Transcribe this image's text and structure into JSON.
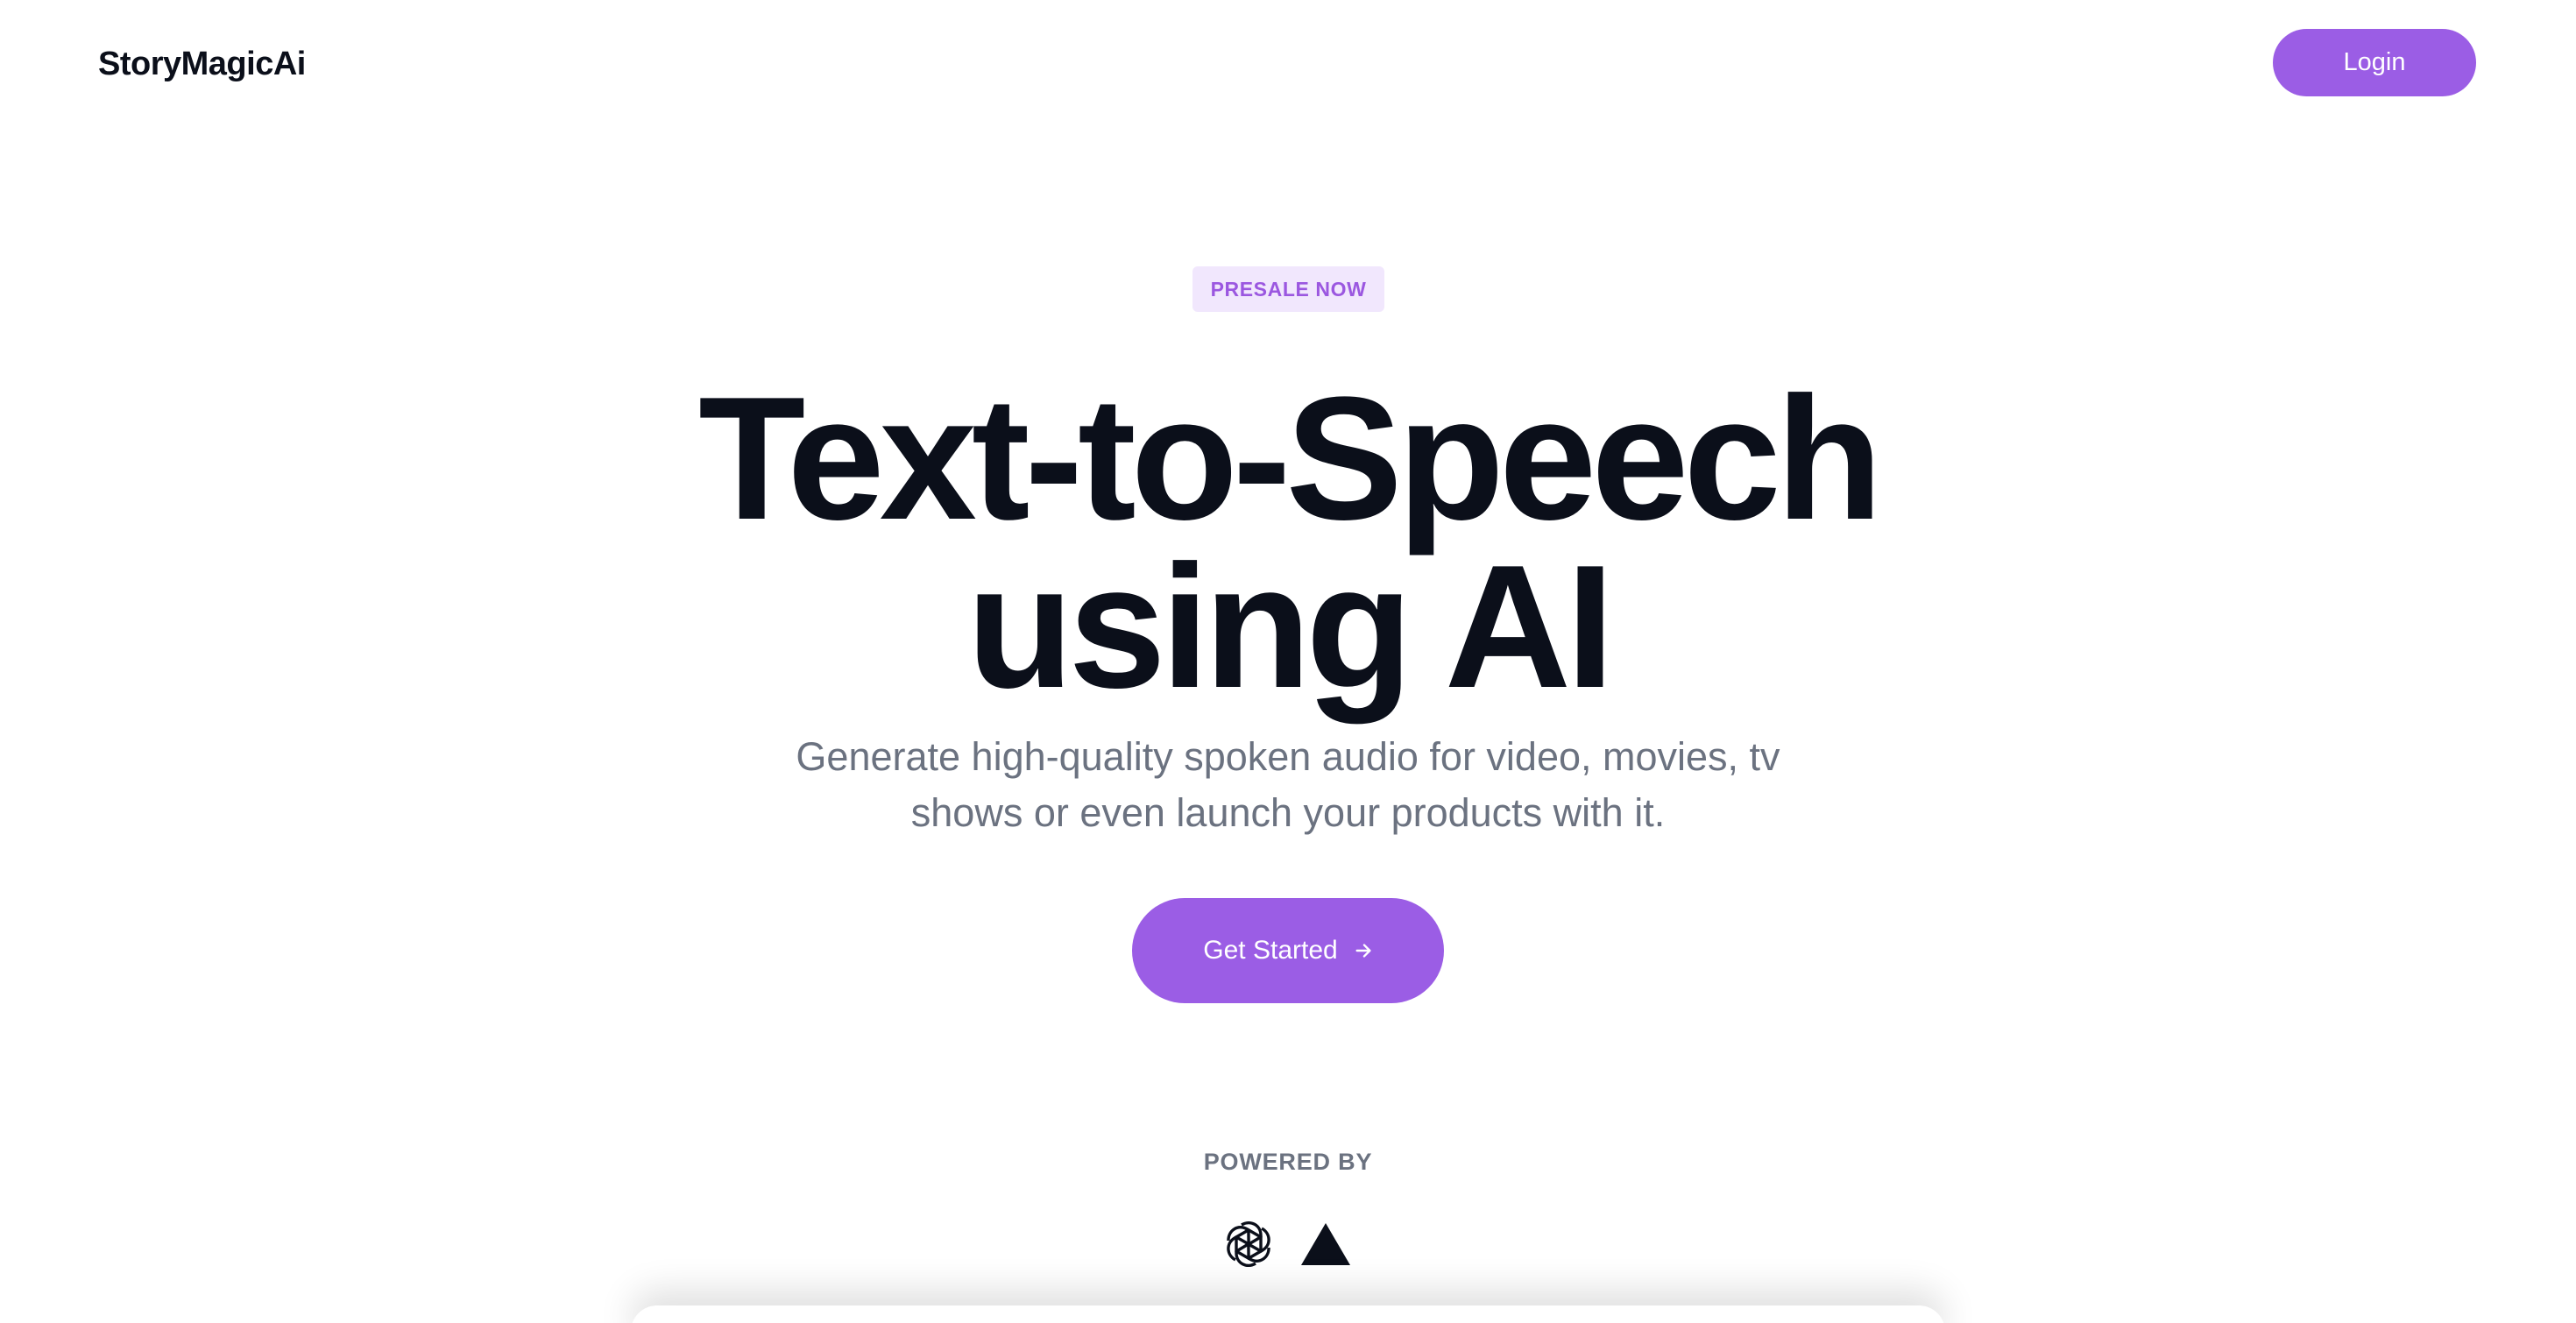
{
  "header": {
    "brand": "StoryMagicAi",
    "login_label": "Login"
  },
  "hero": {
    "badge": "PRESALE NOW",
    "headline_line1": "Text-to-Speech",
    "headline_line2": "using AI",
    "subtitle_line1": "Generate high-quality spoken audio for video, movies, tv",
    "subtitle_line2": "shows or even launch your products with it.",
    "cta_label": "Get Started",
    "cta_icon": "arrow-right-icon"
  },
  "powered_by": {
    "label": "POWERED BY",
    "logos": [
      "openai-logo",
      "vercel-logo"
    ]
  },
  "colors": {
    "accent": "#9b5de5",
    "badge_bg": "#f1e7fd",
    "badge_text": "#9b57e0",
    "heading": "#0b0f1a",
    "muted": "#6b7280",
    "background": "#ffffff"
  }
}
